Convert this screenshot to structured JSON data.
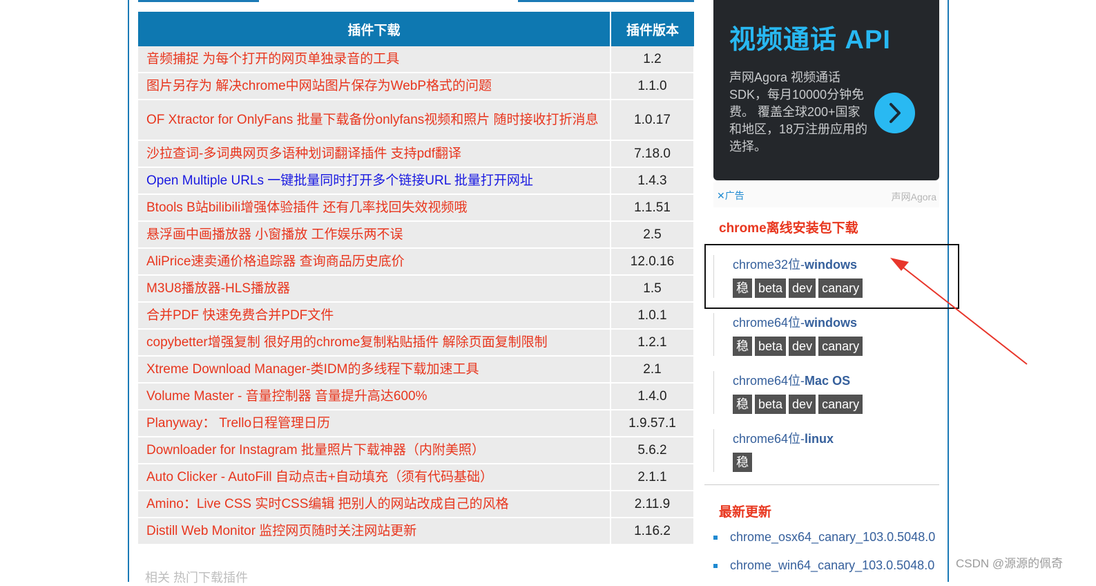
{
  "table": {
    "headers": {
      "name": "插件下载",
      "version": "插件版本"
    },
    "rows": [
      {
        "name": "音频捕捉 为每个打开的网页单独录音的工具",
        "version": "1.2"
      },
      {
        "name": "图片另存为 解决chrome中网站图片保存为WebP格式的问题",
        "version": "1.1.0"
      },
      {
        "name": "OF Xtractor for OnlyFans 批量下载备份onlyfans视频和照片 随时接收打折消息",
        "version": "1.0.17"
      },
      {
        "name": "沙拉查词-多词典网页多语种划词翻译插件 支持pdf翻译",
        "version": "7.18.0"
      },
      {
        "name": "Open Multiple URLs 一键批量同时打开多个链接URL 批量打开网址",
        "version": "1.4.3"
      },
      {
        "name": "Btools B站bilibili增强体验插件 还有几率找回失效视频哦",
        "version": "1.1.51"
      },
      {
        "name": "悬浮画中画播放器 小窗播放 工作娱乐两不误",
        "version": "2.5"
      },
      {
        "name": "AliPrice速卖通价格追踪器 查询商品历史底价",
        "version": "12.0.16"
      },
      {
        "name": "M3U8播放器-HLS播放器",
        "version": "1.5"
      },
      {
        "name": "合并PDF 快速免费合并PDF文件",
        "version": "1.0.1"
      },
      {
        "name": "copybetter增强复制 很好用的chrome复制粘贴插件 解除页面复制限制",
        "version": "1.2.1"
      },
      {
        "name": "Xtreme Download Manager-类IDM的多线程下载加速工具",
        "version": "2.1"
      },
      {
        "name": "Volume Master - 音量控制器 音量提升高达600%",
        "version": "1.4.0"
      },
      {
        "name": "Planyway： Trello日程管理日历",
        "version": "1.9.57.1"
      },
      {
        "name": "Downloader for Instagram 批量照片下载神器（内附美照）",
        "version": "5.6.2"
      },
      {
        "name": "Auto Clicker - AutoFill 自动点击+自动填充（须有代码基础）",
        "version": "2.1.1"
      },
      {
        "name": "Amino：Live CSS 实时CSS编辑 把别人的网站改成自己的风格",
        "version": "2.11.9"
      },
      {
        "name": "Distill Web Monitor 监控网页随时关注网站更新",
        "version": "1.16.2"
      }
    ]
  },
  "below_table_text": "相关 热门下载插件",
  "ad": {
    "title": "视频通话 API",
    "description": "声网Agora 视频通话SDK，每月10000分钟免费。 覆盖全球200+国家和地区，18万注册应用的选择。",
    "close_label": "✕广告",
    "brand": "声网Agora"
  },
  "offline": {
    "title": "chrome离线安装包下载",
    "groups": [
      {
        "prefix": "chrome32位-",
        "suffix": "windows",
        "badges": [
          "稳定版",
          "beta版",
          "dev版",
          "canary版"
        ]
      },
      {
        "prefix": "chrome64位-",
        "suffix": "windows",
        "badges": [
          "稳定版",
          "beta版",
          "dev版",
          "canary版"
        ]
      },
      {
        "prefix": "chrome64位-",
        "suffix": "Mac OS",
        "badges": [
          "稳定版",
          "beta版",
          "dev版",
          "canary版"
        ]
      },
      {
        "prefix": "chrome64位-",
        "suffix": "linux",
        "badges": [
          "稳定版"
        ]
      }
    ]
  },
  "updates": {
    "title": "最新更新",
    "items": [
      "chrome_osx64_canary_103.0.5048.0",
      "chrome_win64_canary_103.0.5048.0"
    ]
  },
  "watermark": "CSDN @源源的佩奇",
  "colors": {
    "accent": "#0e78b1",
    "link_red": "#e8361e",
    "link_blue": "#1a1ae0",
    "annotation": "#e8362b"
  }
}
